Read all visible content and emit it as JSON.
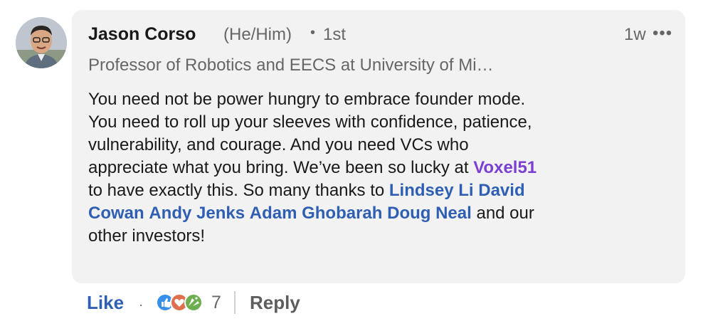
{
  "comment": {
    "author": {
      "name": "Jason Corso",
      "pronouns": "(He/Him)",
      "separator": "•",
      "degree": "1st",
      "headline": "Professor of Robotics and EECS at University of Mi…"
    },
    "time": "1w",
    "more_label": "•••",
    "body": {
      "line1": "You need not be power hungry to embrace founder mode.",
      "line2": "You need to roll up your sleeves with confidence, patience,",
      "line3": "vulnerability, and courage. And you need VCs who",
      "line4_text": "appreciate what you bring. We’ve been so lucky at ",
      "mention_company": "Voxel51",
      "line5_text": " to have exactly this. So many thanks to ",
      "mention_1": "Lindsey Li",
      "mention_2a": "David",
      "mention_2b": "Cowan",
      "mention_3": "Andy Jenks",
      "mention_4": "Adam Ghobarah",
      "mention_5": "Doug Neal",
      "line6_tail": " and our",
      "line7": "other investors!"
    }
  },
  "actions": {
    "like_label": "Like",
    "dot": "·",
    "reaction_count": "7",
    "reply_label": "Reply"
  },
  "reactions": [
    "like-icon",
    "love-icon",
    "celebrate-icon"
  ]
}
